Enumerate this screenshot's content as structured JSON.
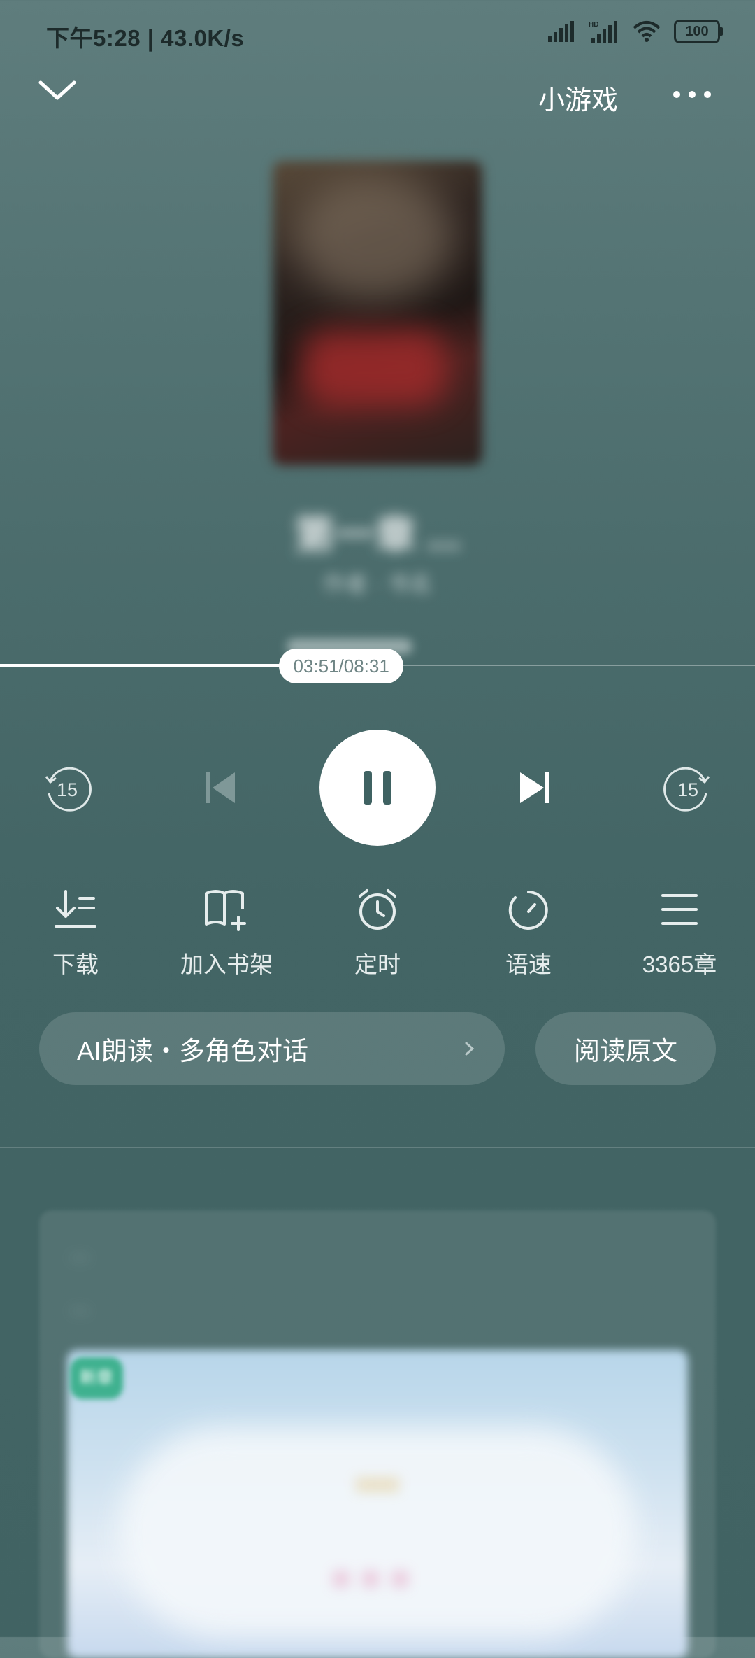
{
  "status_bar": {
    "time_speed": "下午5:28 | 43.0K/s",
    "battery": "100"
  },
  "top_bar": {
    "mini_game_label": "小游戏"
  },
  "player": {
    "chapter_title": "第一章 ...",
    "book_meta": "作者 · 书名",
    "elapsed_total": "03:51/08:31",
    "progress_fraction": 0.452,
    "skip_back_seconds": "15",
    "skip_forward_seconds": "15"
  },
  "functions": [
    {
      "label": "下载",
      "icon": "download-icon"
    },
    {
      "label": "加入书架",
      "icon": "add-bookshelf-icon"
    },
    {
      "label": "定时",
      "icon": "alarm-clock-icon"
    },
    {
      "label": "语速",
      "icon": "speed-gauge-icon"
    },
    {
      "label": "3365章",
      "icon": "chapter-list-icon"
    }
  ],
  "actions": {
    "ai_read_label": "AI朗读・多角色对话",
    "read_original_label": "阅读原文"
  },
  "card": {
    "text": "...",
    "text_line2": "...",
    "badge": "新章",
    "banner_title": "...",
    "banner_subtitle": "..."
  },
  "colors": {
    "background": "#4b6c6c",
    "accent_white": "#ffffff",
    "badge_green": "#3fb18f"
  }
}
